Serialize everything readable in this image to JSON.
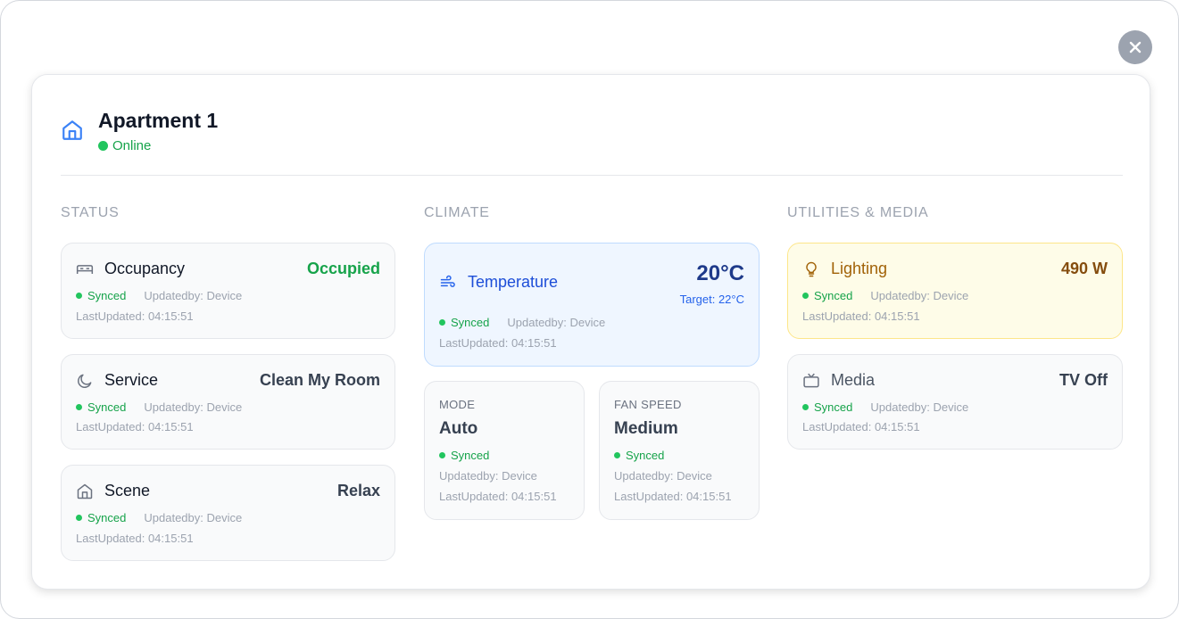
{
  "close_label": "×",
  "header": {
    "title": "Apartment 1",
    "status": "Online"
  },
  "colors": {
    "online": "#16a34a",
    "accent_blue": "#1d4ed8",
    "lighting": "#854d0e"
  },
  "columns": {
    "status": "STATUS",
    "climate": "CLIMATE",
    "utilities": "UTILITIES & MEDIA"
  },
  "status_tiles": [
    {
      "name": "Occupancy",
      "value": "Occupied",
      "icon": "bed-icon",
      "synced": "Synced",
      "updated_by": "Updatedby: Device",
      "last_updated": "LastUpdated: 04:15:51"
    },
    {
      "name": "Service",
      "value": "Clean My Room",
      "icon": "moon-icon",
      "synced": "Synced",
      "updated_by": "Updatedby: Device",
      "last_updated": "LastUpdated: 04:15:51"
    },
    {
      "name": "Scene",
      "value": "Relax",
      "icon": "home-icon",
      "synced": "Synced",
      "updated_by": "Updatedby: Device",
      "last_updated": "LastUpdated: 04:15:51"
    }
  ],
  "climate": {
    "temperature": {
      "name": "Temperature",
      "value": "20°C",
      "target": "Target: 22°C",
      "icon": "wind-icon",
      "synced": "Synced",
      "updated_by": "Updatedby: Device",
      "last_updated": "LastUpdated: 04:15:51"
    },
    "mode": {
      "label": "MODE",
      "value": "Auto",
      "synced": "Synced",
      "updated_by": "Updatedby: Device",
      "last_updated": "LastUpdated: 04:15:51"
    },
    "fan": {
      "label": "FAN SPEED",
      "value": "Medium",
      "synced": "Synced",
      "updated_by": "Updatedby: Device",
      "last_updated": "LastUpdated: 04:15:51"
    }
  },
  "utilities": [
    {
      "name": "Lighting",
      "value": "490 W",
      "icon": "bulb-icon",
      "synced": "Synced",
      "updated_by": "Updatedby: Device",
      "last_updated": "LastUpdated: 04:15:51"
    },
    {
      "name": "Media",
      "value": "TV Off",
      "icon": "tv-icon",
      "synced": "Synced",
      "updated_by": "Updatedby: Device",
      "last_updated": "LastUpdated: 04:15:51"
    }
  ]
}
